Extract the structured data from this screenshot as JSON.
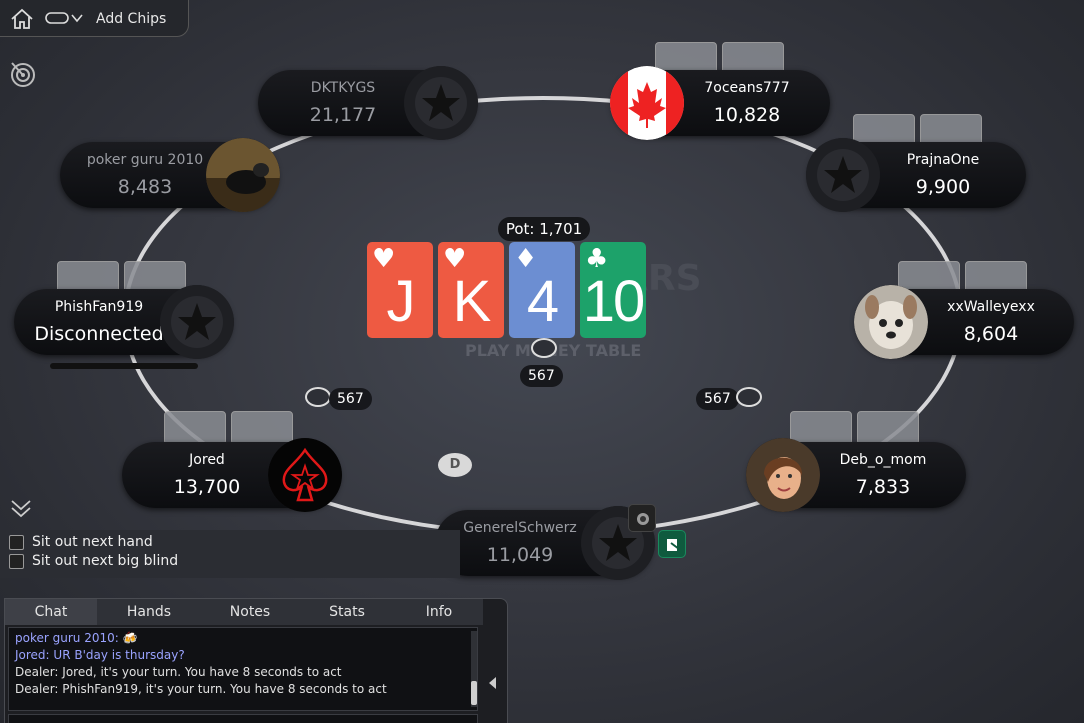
{
  "toolbar": {
    "add_chips_label": "Add Chips",
    "icons": [
      "home-icon",
      "toggle-icon",
      "target-icon",
      "collapse-icon"
    ]
  },
  "table": {
    "pot_label": "Pot: 1,701",
    "watermark": "PLAY MONEY TABLE",
    "watermark_brand": "ARS",
    "dealer_button": "D",
    "board": [
      {
        "rank": "J",
        "suit": "♥",
        "color": "#ee5a42"
      },
      {
        "rank": "K",
        "suit": "♥",
        "color": "#ee5a42"
      },
      {
        "rank": "4",
        "suit": "♦",
        "color": "#6c8ed2"
      },
      {
        "rank": "10",
        "suit": "♣",
        "color": "#1da26a"
      }
    ],
    "bets": {
      "center": "567",
      "left": "567",
      "right": "567"
    }
  },
  "players": {
    "dktkygs": {
      "name": "DKTKYGS",
      "stack": "21,177"
    },
    "oceans": {
      "name": "7oceans777",
      "stack": "10,828"
    },
    "pokerguru": {
      "name": "poker guru 2010",
      "stack": "8,483"
    },
    "prajna": {
      "name": "PrajnaOne",
      "stack": "9,900"
    },
    "phishfan": {
      "name": "PhishFan919",
      "stack": "Disconnected"
    },
    "walleye": {
      "name": "xxWalleyexx",
      "stack": "8,604"
    },
    "jored": {
      "name": "Jored",
      "stack": "13,700"
    },
    "deb": {
      "name": "Deb_o_mom",
      "stack": "7,833"
    },
    "generel": {
      "name": "GenerelSchwerz",
      "stack": "11,049"
    }
  },
  "options": {
    "sit_out_hand": "Sit out next hand",
    "sit_out_bb": "Sit out next big blind"
  },
  "panel": {
    "tabs": [
      "Chat",
      "Hands",
      "Notes",
      "Stats",
      "Info"
    ],
    "chat": [
      {
        "text": "poker guru 2010: 🍻",
        "color": "#9aa3ff"
      },
      {
        "text": "Jored: UR B'day is thursday?",
        "color": "#9aa3ff"
      },
      {
        "text": "Dealer: Jored, it's your turn. You have 8 seconds to act",
        "color": "#e0e0e0"
      },
      {
        "text": "Dealer: PhishFan919, it's your turn. You have 8 seconds to act",
        "color": "#e0e0e0"
      }
    ]
  }
}
